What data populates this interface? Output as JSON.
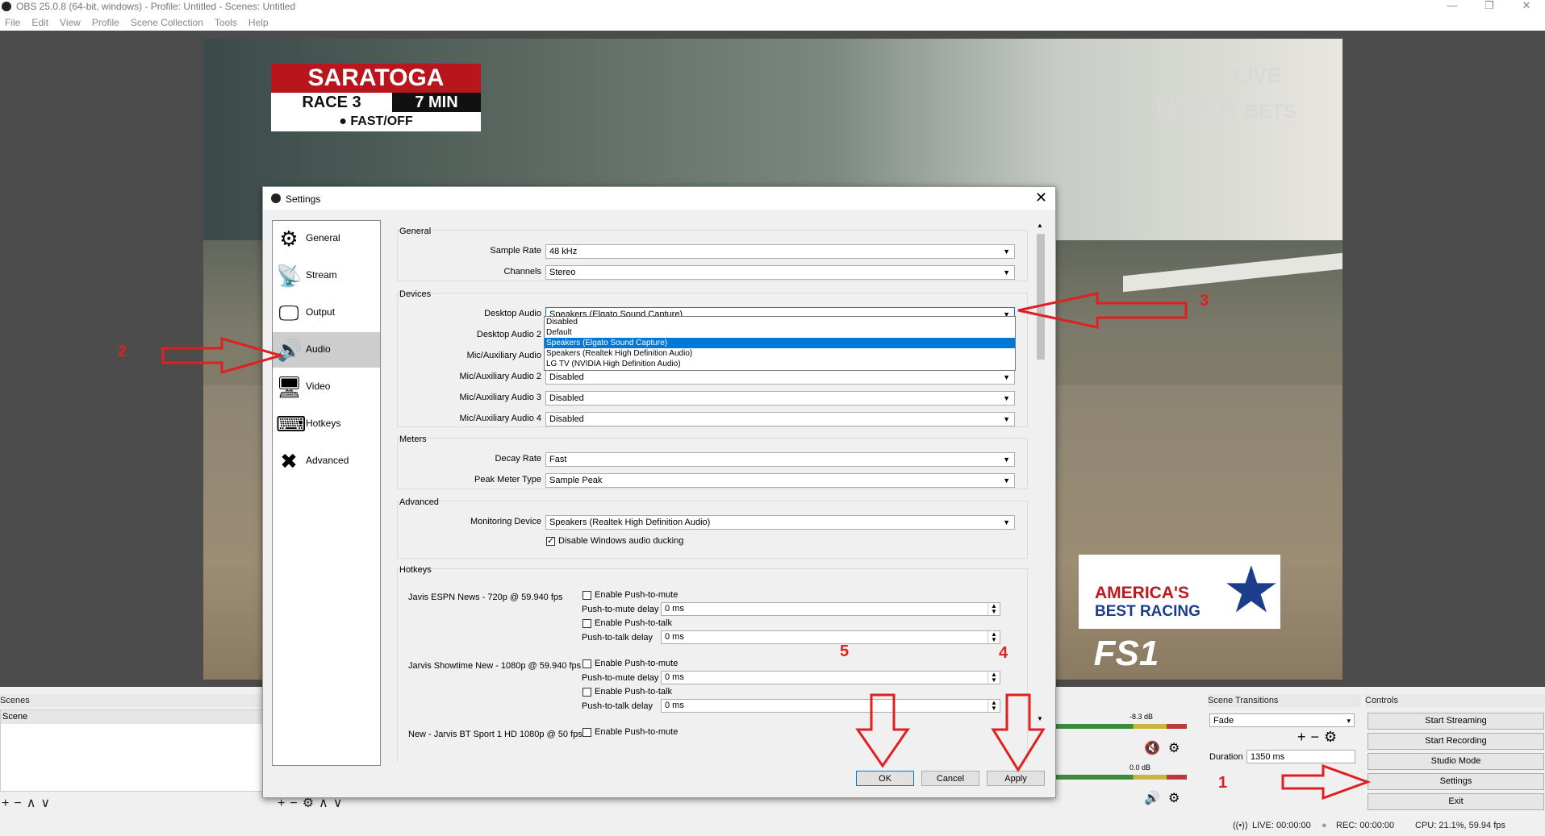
{
  "window": {
    "title": "OBS 25.0.8 (64-bit, windows) - Profile: Untitled - Scenes: Untitled",
    "menu": [
      "File",
      "Edit",
      "View",
      "Profile",
      "Scene Collection",
      "Tools",
      "Help"
    ],
    "buttons": {
      "minimize": "—",
      "restore": "❐",
      "close": "✕"
    }
  },
  "preview": {
    "saratoga": {
      "title": "SARATOGA",
      "race": "RACE 3",
      "time": "7 MIN",
      "status": "● FAST/OFF"
    },
    "live": "LIVE",
    "nyra": "NYRA",
    "bets": "BETS",
    "abr_line1": "AMERICA'S",
    "abr_line2": "BEST RACING",
    "fs1": "FS1"
  },
  "docks": {
    "scenes_header": "Scenes",
    "scenes": [
      "Scene"
    ],
    "transitions_header": "Scene Transitions",
    "transition_value": "Fade",
    "duration_label": "Duration",
    "duration_value": "1350 ms",
    "controls_header": "Controls",
    "controls": [
      "Start Streaming",
      "Start Recording",
      "Studio Mode",
      "Settings",
      "Exit"
    ],
    "mixer_db": [
      "-8.3 dB",
      "0.0 dB"
    ]
  },
  "status": {
    "live": "LIVE: 00:00:00",
    "rec": "REC: 00:00:00",
    "cpu": "CPU: 21.1%, 59.94 fps"
  },
  "dialog": {
    "title": "Settings",
    "close": "✕",
    "nav": [
      {
        "label": "General",
        "icon": "gear-icon",
        "glyph": "⚙"
      },
      {
        "label": "Stream",
        "icon": "antenna-icon",
        "glyph": "📡"
      },
      {
        "label": "Output",
        "icon": "monitor-output-icon",
        "glyph": "🖵"
      },
      {
        "label": "Audio",
        "icon": "speaker-icon",
        "glyph": "🔊"
      },
      {
        "label": "Video",
        "icon": "monitor-icon",
        "glyph": "🖥"
      },
      {
        "label": "Hotkeys",
        "icon": "keyboard-icon",
        "glyph": "⌨"
      },
      {
        "label": "Advanced",
        "icon": "tools-icon",
        "glyph": "✖"
      }
    ],
    "active_nav": "Audio",
    "general": {
      "title": "General",
      "sample_rate_label": "Sample Rate",
      "sample_rate": "48 kHz",
      "channels_label": "Channels",
      "channels": "Stereo"
    },
    "devices": {
      "title": "Devices",
      "desktop_audio_label": "Desktop Audio",
      "desktop_audio": "Speakers (Elgato Sound Capture)",
      "desktop_audio2_label": "Desktop Audio 2",
      "mic1_label": "Mic/Auxiliary Audio",
      "mic2_label": "Mic/Auxiliary Audio 2",
      "mic2": "Disabled",
      "mic3_label": "Mic/Auxiliary Audio 3",
      "mic3": "Disabled",
      "mic4_label": "Mic/Auxiliary Audio 4",
      "mic4": "Disabled",
      "dropdown_options": [
        "Disabled",
        "Default",
        "Speakers (Elgato Sound Capture)",
        "Speakers (Realtek High Definition Audio)",
        "LG TV (NVIDIA High Definition Audio)"
      ],
      "dropdown_selected": "Speakers (Elgato Sound Capture)"
    },
    "meters": {
      "title": "Meters",
      "decay_label": "Decay Rate",
      "decay": "Fast",
      "peak_label": "Peak Meter Type",
      "peak": "Sample Peak"
    },
    "advanced": {
      "title": "Advanced",
      "monitoring_label": "Monitoring Device",
      "monitoring": "Speakers (Realtek High Definition Audio)",
      "ducking_label": "Disable Windows audio ducking",
      "ducking_checked": true
    },
    "hotkeys": {
      "title": "Hotkeys",
      "sources": [
        {
          "name": "Javis ESPN News - 720p @ 59.940 fps",
          "ptm_label": "Enable Push-to-mute",
          "ptm_delay_label": "Push-to-mute delay",
          "ptm_delay": "0 ms",
          "ptt_label": "Enable Push-to-talk",
          "ptt_delay_label": "Push-to-talk delay",
          "ptt_delay": "0 ms"
        },
        {
          "name": "Jarvis Showtime New - 1080p @ 59.940 fps",
          "ptm_label": "Enable Push-to-mute",
          "ptm_delay_label": "Push-to-mute delay",
          "ptm_delay": "0 ms",
          "ptt_label": "Enable Push-to-talk",
          "ptt_delay_label": "Push-to-talk delay",
          "ptt_delay": "0 ms"
        },
        {
          "name": "New - Jarvis BT Sport 1 HD 1080p @ 50 fps",
          "ptm_label": "Enable Push-to-mute"
        }
      ]
    },
    "buttons": {
      "ok": "OK",
      "cancel": "Cancel",
      "apply": "Apply"
    }
  },
  "annotations": [
    "1",
    "2",
    "3",
    "4",
    "5"
  ],
  "colors": {
    "annotation": "#e02020",
    "selection": "#0078d7"
  }
}
